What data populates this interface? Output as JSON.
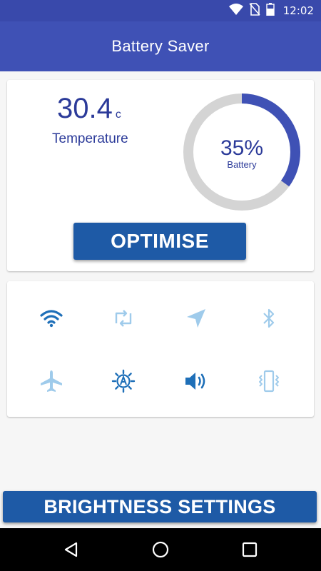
{
  "status_bar": {
    "time": "12:02",
    "icons": [
      "wifi-icon",
      "no-sim-icon",
      "battery-icon"
    ]
  },
  "app_bar": {
    "title": "Battery Saver"
  },
  "temperature": {
    "value": "30.4",
    "unit": "c",
    "label": "Temperature"
  },
  "battery": {
    "percent_text": "35%",
    "label": "Battery",
    "level": 0.35
  },
  "optimise_button": {
    "label": "OPTIMISE"
  },
  "toggles": [
    {
      "name": "wifi",
      "icon": "wifi-icon",
      "active": true
    },
    {
      "name": "sync",
      "icon": "sync-icon",
      "active": false
    },
    {
      "name": "location",
      "icon": "location-icon",
      "active": false
    },
    {
      "name": "bluetooth",
      "icon": "bluetooth-icon",
      "active": false
    },
    {
      "name": "airplane-mode",
      "icon": "airplane-icon",
      "active": false
    },
    {
      "name": "auto-brightness",
      "icon": "auto-brightness-icon",
      "active": true
    },
    {
      "name": "sound",
      "icon": "sound-icon",
      "active": true
    },
    {
      "name": "vibrate",
      "icon": "vibrate-icon",
      "active": false
    }
  ],
  "brightness_button": {
    "label": "BRIGHTNESS SETTINGS"
  },
  "colors": {
    "status_bar": "#3949ab",
    "app_bar": "#3f51b5",
    "text_primary": "#2b3a99",
    "button": "#1e5aa6",
    "toggle_active": "#1e6fb8",
    "toggle_inactive": "#9fcbeb",
    "gauge_track": "#d4d4d4",
    "gauge_fill": "#3f51b5"
  },
  "nav_bar": {
    "buttons": [
      "back-icon",
      "home-icon",
      "recents-icon"
    ]
  }
}
